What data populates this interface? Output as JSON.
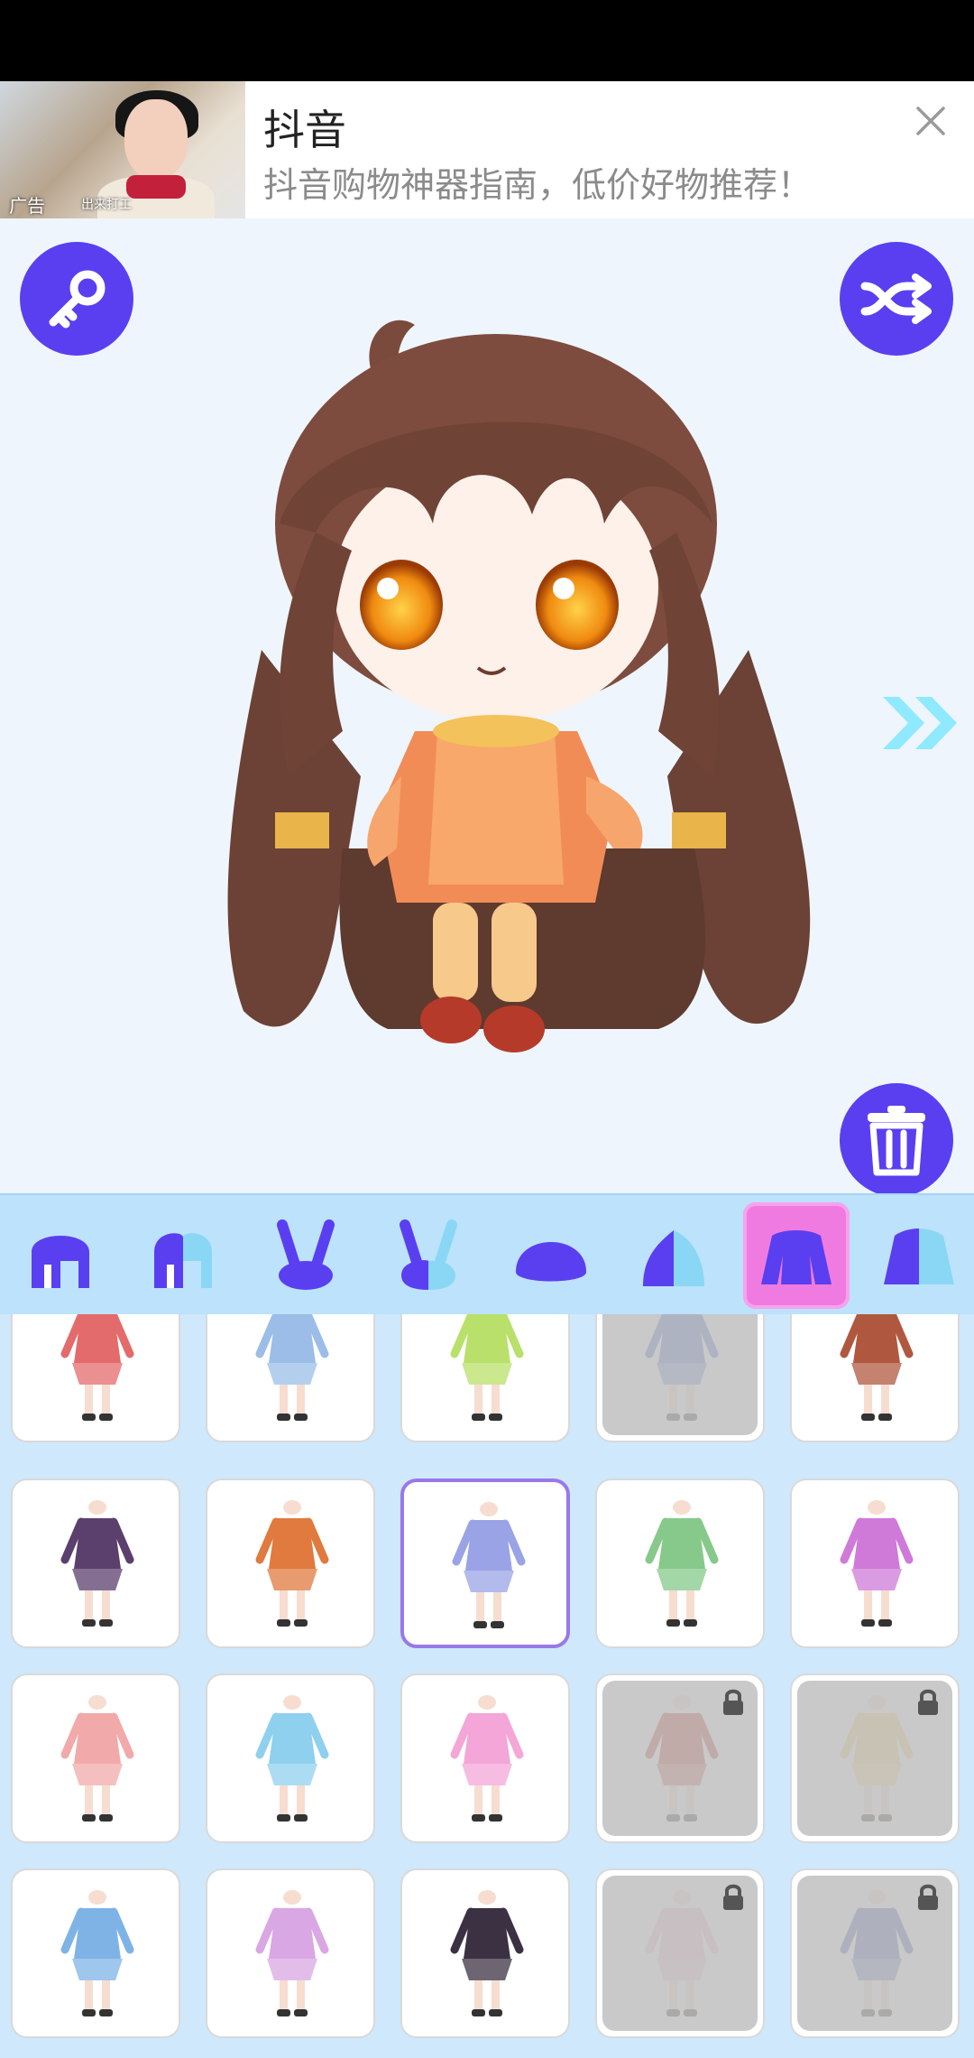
{
  "ad": {
    "title": "抖音",
    "subtitle": "抖音购物神器指南，低价好物推荐！",
    "tag": "广告",
    "thumb_caption": "出来打工"
  },
  "buttons": {
    "key_icon": "key-icon",
    "shuffle_icon": "shuffle-icon",
    "trash_icon": "trash-icon",
    "next_icon": "double-chevron-right-icon"
  },
  "colors": {
    "accent": "#5a3ff0",
    "active_tab": "#f07be0",
    "category_bar": "#bde2fb",
    "grid_bg": "#cfe8fb",
    "selected_border": "#9a78e8",
    "arrow": "#8fe9ff"
  },
  "categories": [
    {
      "name": "front-hair",
      "icon": "front-hair-icon",
      "active": false
    },
    {
      "name": "front-hair-alt",
      "icon": "front-hair-half-icon",
      "active": false
    },
    {
      "name": "ears",
      "icon": "bunny-ears-icon",
      "active": false
    },
    {
      "name": "ears-alt",
      "icon": "bunny-ears-half-icon",
      "active": false
    },
    {
      "name": "hat",
      "icon": "blob-icon",
      "active": false
    },
    {
      "name": "accessory",
      "icon": "blob-half-icon",
      "active": false
    },
    {
      "name": "outfit",
      "icon": "shirt-icon",
      "active": true
    },
    {
      "name": "outfit-alt",
      "icon": "shirt-half-icon",
      "active": false
    }
  ],
  "items": [
    {
      "row": 0,
      "col": 0,
      "locked": false,
      "selected": false,
      "color": "#e46b6b"
    },
    {
      "row": 0,
      "col": 1,
      "locked": false,
      "selected": false,
      "color": "#9bbde8"
    },
    {
      "row": 0,
      "col": 2,
      "locked": false,
      "selected": false,
      "color": "#b9e06a"
    },
    {
      "row": 0,
      "col": 3,
      "locked": true,
      "selected": false,
      "color": "#4a6fd0"
    },
    {
      "row": 0,
      "col": 4,
      "locked": false,
      "selected": false,
      "color": "#b0583f"
    },
    {
      "row": 1,
      "col": 0,
      "locked": false,
      "selected": false,
      "color": "#5b3f6d"
    },
    {
      "row": 1,
      "col": 1,
      "locked": false,
      "selected": false,
      "color": "#e07a3e"
    },
    {
      "row": 1,
      "col": 2,
      "locked": false,
      "selected": true,
      "color": "#9aa3e6"
    },
    {
      "row": 1,
      "col": 3,
      "locked": false,
      "selected": false,
      "color": "#86c98a"
    },
    {
      "row": 1,
      "col": 4,
      "locked": false,
      "selected": false,
      "color": "#cf7ad8"
    },
    {
      "row": 2,
      "col": 0,
      "locked": false,
      "selected": false,
      "color": "#f2a9a9"
    },
    {
      "row": 2,
      "col": 1,
      "locked": false,
      "selected": false,
      "color": "#8fd0ee"
    },
    {
      "row": 2,
      "col": 2,
      "locked": false,
      "selected": false,
      "color": "#f3a6d7"
    },
    {
      "row": 2,
      "col": 3,
      "locked": true,
      "selected": false,
      "color": "#c0392b"
    },
    {
      "row": 2,
      "col": 4,
      "locked": true,
      "selected": false,
      "color": "#f2cf6a"
    },
    {
      "row": 3,
      "col": 0,
      "locked": false,
      "selected": false,
      "color": "#7fb3e6"
    },
    {
      "row": 3,
      "col": 1,
      "locked": false,
      "selected": false,
      "color": "#d9a7e3"
    },
    {
      "row": 3,
      "col": 2,
      "locked": false,
      "selected": false,
      "color": "#3c3142"
    },
    {
      "row": 3,
      "col": 3,
      "locked": true,
      "selected": false,
      "color": "#f2b8c8"
    },
    {
      "row": 3,
      "col": 4,
      "locked": true,
      "selected": false,
      "color": "#4b5cab"
    }
  ]
}
